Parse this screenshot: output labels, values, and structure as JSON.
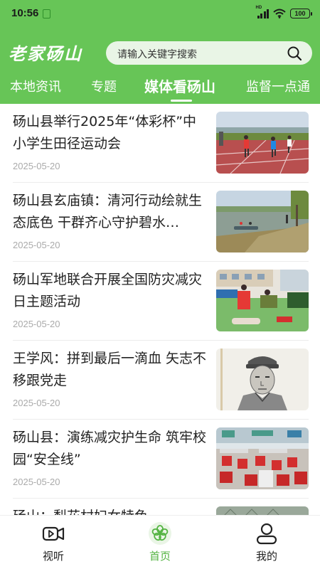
{
  "status_bar": {
    "time": "10:56",
    "battery": "100"
  },
  "app": {
    "logo_text": "老家砀山"
  },
  "search": {
    "placeholder": "请输入关键字搜索"
  },
  "tabs": [
    {
      "label": "本地资讯",
      "active": false
    },
    {
      "label": "专题",
      "active": false
    },
    {
      "label": "媒体看砀山",
      "active": true
    },
    {
      "label": "监督一点通",
      "active": false
    }
  ],
  "news": [
    {
      "title": "砀山县举行2025年“体彩杯”中小学生田径运动会",
      "date": "2025-05-20"
    },
    {
      "title": "砀山县玄庙镇：清河行动绘就生态底色 干群齐心守护碧水…",
      "date": "2025-05-20"
    },
    {
      "title": "砀山军地联合开展全国防灾减灾日主题活动",
      "date": "2025-05-20"
    },
    {
      "title": "王学风：拼到最后一滴血 矢志不移跟党走",
      "date": "2025-05-20"
    },
    {
      "title": "砀山县：演练减灾护生命 筑牢校园“安全线”",
      "date": "2025-05-20"
    },
    {
      "title": "砀山：梨花村妇女特色",
      "date": ""
    }
  ],
  "bottom_nav": [
    {
      "label": "视听",
      "icon": "video-icon",
      "active": false
    },
    {
      "label": "首页",
      "icon": "flower-icon",
      "active": true
    },
    {
      "label": "我的",
      "icon": "user-icon",
      "active": false
    }
  ],
  "colors": {
    "brand_green": "#67c557",
    "active_green": "#53b341"
  }
}
